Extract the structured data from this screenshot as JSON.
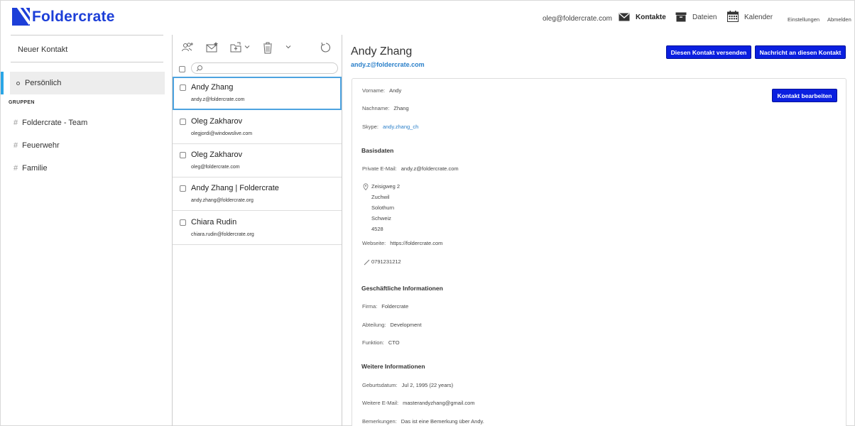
{
  "header": {
    "brand": "Foldercrate",
    "user_email": "oleg@foldercrate.com",
    "nav": {
      "contacts": "Kontakte",
      "files": "Dateien",
      "calendar": "Kalender",
      "settings": "Einstellungen",
      "logout": "Abmelden"
    }
  },
  "sidebar": {
    "new_contact": "Neuer Kontakt",
    "personal": "Persönlich",
    "groups_title": "GRUPPEN",
    "groups": [
      "Foldercrate - Team",
      "Feuerwehr",
      "Familie"
    ]
  },
  "contact_list": {
    "items": [
      {
        "name": "Andy Zhang",
        "email": "andy.z@foldercrate.com",
        "selected": true
      },
      {
        "name": "Oleg Zakharov",
        "email": "olegjordi@windowslive.com"
      },
      {
        "name": "Oleg Zakharov",
        "email": "oleg@foldercrate.com"
      },
      {
        "name": "Andy Zhang | Foldercrate",
        "email": "andy.zhang@foldercrate.org"
      },
      {
        "name": "Chiara Rudin",
        "email": "chiara.rudin@foldercrate.org"
      }
    ]
  },
  "detail": {
    "name": "Andy Zhang",
    "email": "andy.z@foldercrate.com",
    "send_button": "Diesen Kontakt versenden",
    "message_button": "Nachricht an diesen Kontakt",
    "edit_button": "Kontakt bearbeiten",
    "firstname_label": "Vorname:",
    "firstname": "Andy",
    "lastname_label": "Nachname:",
    "lastname": "Zhang",
    "skype_label": "Skype:",
    "skype": "andy.zhang_ch",
    "basis_title": "Basisdaten",
    "private_email_label": "Private E-Mail:",
    "private_email": "andy.z@foldercrate.com",
    "address": {
      "street": "Zeisigweg 2",
      "city": "Zuchwil",
      "canton": "Solothurn",
      "country": "Schweiz",
      "zip": "4528"
    },
    "website_label": "Webseite:",
    "website": "https://foldercrate.com",
    "phone": "0791231212",
    "business_title": "Geschäftliche Informationen",
    "company_label": "Firma:",
    "company": "Foldercrate",
    "department_label": "Abteilung:",
    "department": "Development",
    "function_label": "Funktion:",
    "function": "CTO",
    "more_title": "Weitere Informationen",
    "birthday_label": "Geburtsdatum:",
    "birthday": "Jul 2, 1995 (22 years)",
    "other_email_label": "Weitere E-Mail:",
    "other_email": "masterandyzhang@gmail.com",
    "notes_label": "Bemerkungen:",
    "notes": "Das ist eine Bemerkung über Andy."
  },
  "colors": {
    "brand": "#1d3fd8",
    "button": "#0a1fe0",
    "link": "#2a7fc9",
    "active_indicator": "#2aa6e6"
  }
}
